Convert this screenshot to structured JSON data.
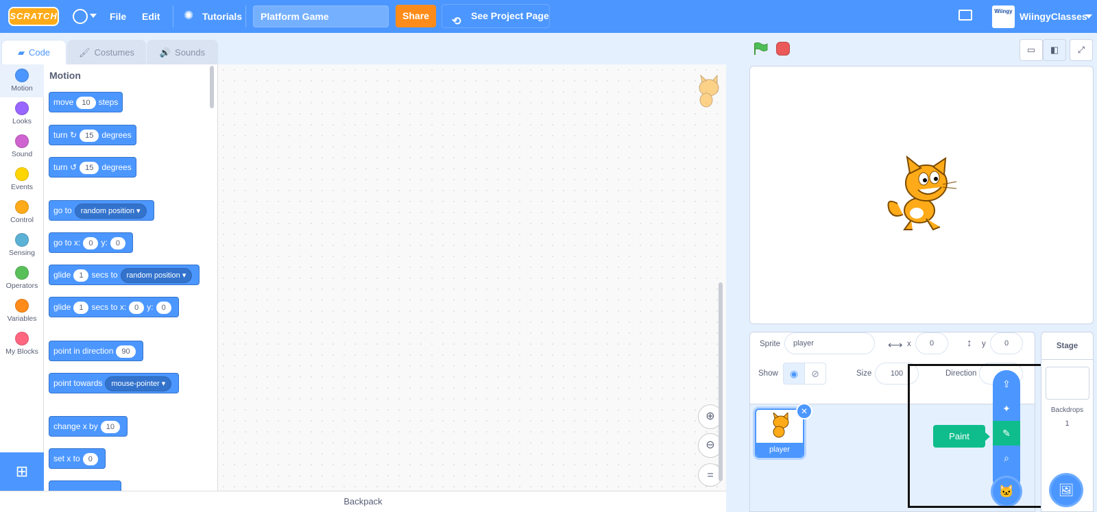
{
  "menubar": {
    "logo": "SCRATCH",
    "file": "File",
    "edit": "Edit",
    "tutorials": "Tutorials",
    "project_title": "Platform Game",
    "share": "Share",
    "see_project_page": "See Project Page",
    "avatar_text": "Wiingy",
    "username": "WiingyClasses"
  },
  "tabs": [
    {
      "label": "Code",
      "active": true
    },
    {
      "label": "Costumes",
      "active": false
    },
    {
      "label": "Sounds",
      "active": false
    }
  ],
  "categories": [
    {
      "label": "Motion",
      "color": "#4c97ff"
    },
    {
      "label": "Looks",
      "color": "#9966ff"
    },
    {
      "label": "Sound",
      "color": "#cf63cf"
    },
    {
      "label": "Events",
      "color": "#ffd500"
    },
    {
      "label": "Control",
      "color": "#ffab19"
    },
    {
      "label": "Sensing",
      "color": "#5cb1d6"
    },
    {
      "label": "Operators",
      "color": "#59c059"
    },
    {
      "label": "Variables",
      "color": "#ff8c1a"
    },
    {
      "label": "My Blocks",
      "color": "#ff6680"
    }
  ],
  "palette": {
    "title": "Motion",
    "blocks": {
      "move": {
        "a": "move",
        "v1": "10",
        "b": "steps"
      },
      "turn_right": {
        "a": "turn",
        "icon": "↻",
        "v1": "15",
        "b": "degrees"
      },
      "turn_left": {
        "a": "turn",
        "icon": "↺",
        "v1": "15",
        "b": "degrees"
      },
      "go_to": {
        "a": "go to",
        "d1": "random position ▾"
      },
      "go_to_xy": {
        "a": "go to x:",
        "v1": "0",
        "b": "y:",
        "v2": "0"
      },
      "glide_to": {
        "a": "glide",
        "v1": "1",
        "b": "secs to",
        "d1": "random position ▾"
      },
      "glide_xy": {
        "a": "glide",
        "v1": "1",
        "b": "secs to x:",
        "v2": "0",
        "c": "y:",
        "v3": "0"
      },
      "point_dir": {
        "a": "point in direction",
        "v1": "90"
      },
      "point_towards": {
        "a": "point towards",
        "d1": "mouse-pointer ▾"
      },
      "change_x": {
        "a": "change x by",
        "v1": "10"
      },
      "set_x": {
        "a": "set x to",
        "v1": "0"
      }
    }
  },
  "backpack": "Backpack",
  "sprite_info": {
    "sprite_label": "Sprite",
    "sprite_name": "player",
    "x_label": "x",
    "x_value": "0",
    "y_label": "y",
    "y_value": "0",
    "show_label": "Show",
    "size_label": "Size",
    "size_value": "100",
    "direction_label": "Direction"
  },
  "sprites": [
    {
      "name": "player"
    }
  ],
  "add_menu": {
    "tooltip": "Paint"
  },
  "stage_panel": {
    "title": "Stage",
    "backdrops_label": "Backdrops",
    "backdrops_count": "1"
  },
  "colors": {
    "accent": "#4c97ff",
    "share": "#ff8c1a",
    "paint": "#0fbd8c"
  }
}
